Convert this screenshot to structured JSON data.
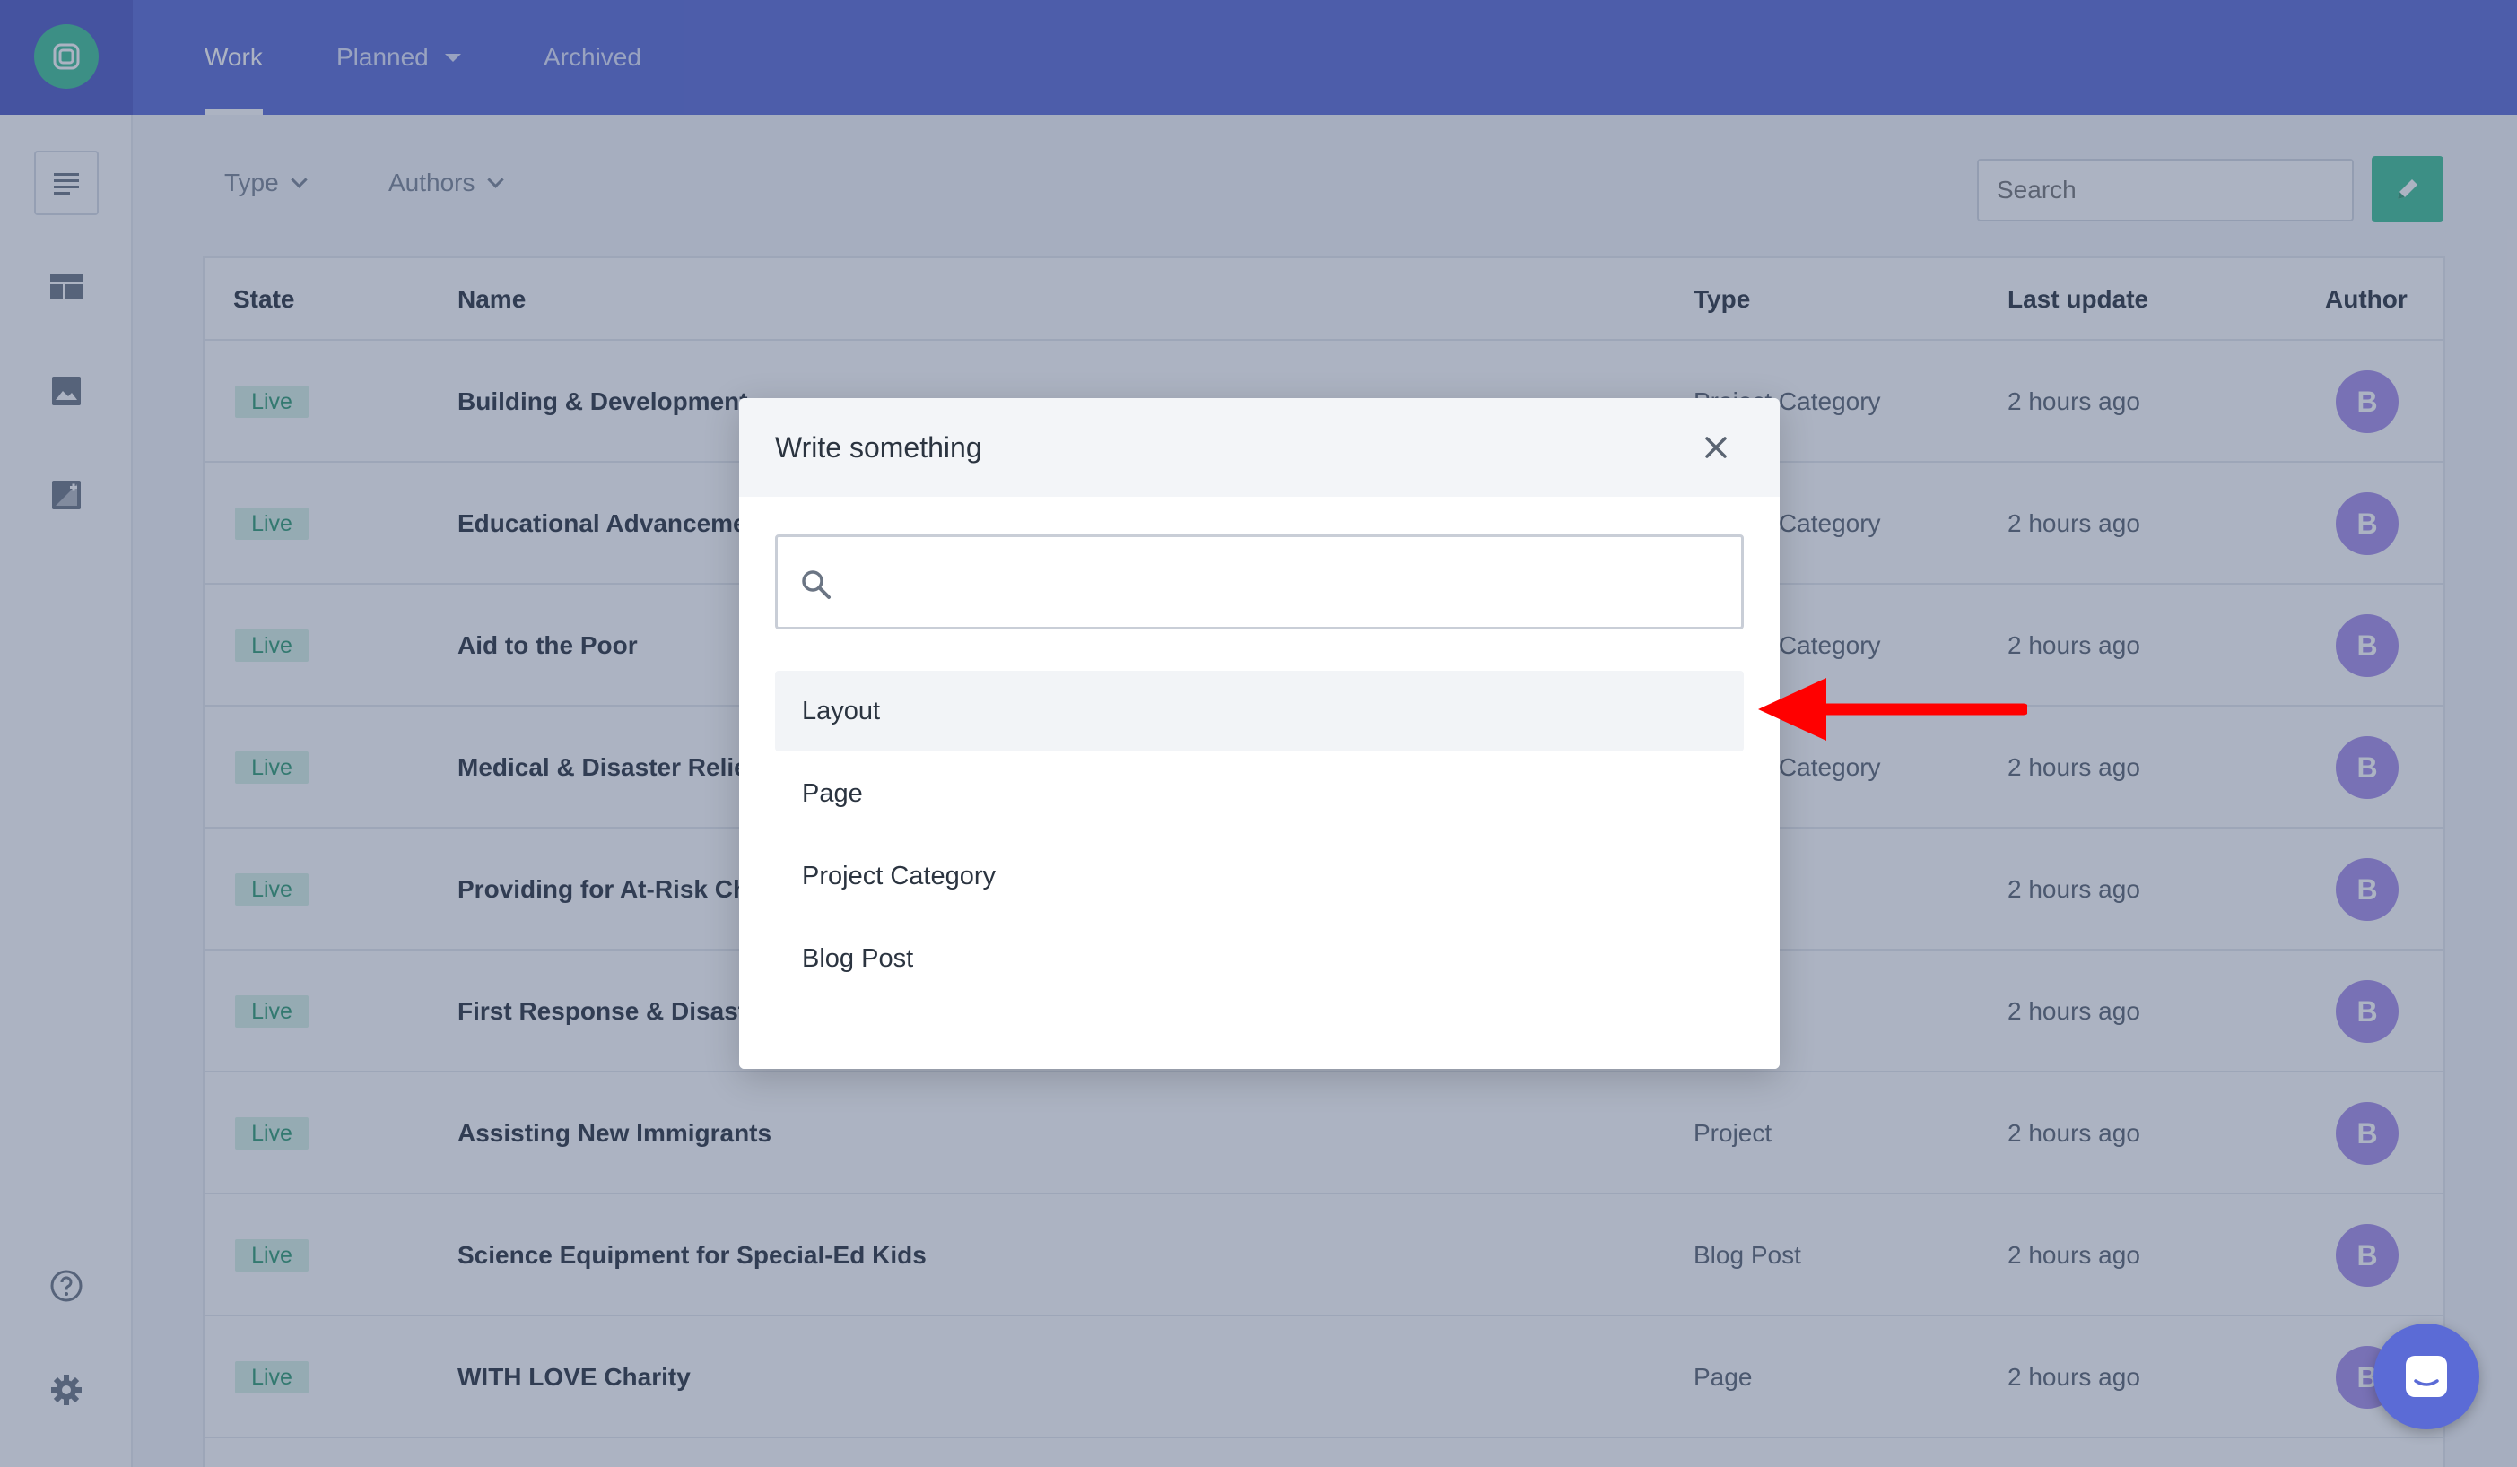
{
  "nav": {
    "tabs": [
      {
        "label": "Work",
        "active": true
      },
      {
        "label": "Planned",
        "has_dropdown": true
      },
      {
        "label": "Archived"
      }
    ]
  },
  "sidebar": {
    "icons": [
      "list-icon",
      "layout-icon",
      "image-icon",
      "image-edit-icon",
      "help-icon",
      "gear-icon"
    ]
  },
  "toolbar": {
    "filters": [
      {
        "label": "Type"
      },
      {
        "label": "Authors"
      }
    ],
    "search_placeholder": "Search",
    "edit_icon": "pencil-icon"
  },
  "table": {
    "columns": [
      "State",
      "Name",
      "Type",
      "Last update",
      "Author"
    ],
    "rows": [
      {
        "state": "Live",
        "name": "Building & Development",
        "type": "Project Category",
        "updated": "2 hours ago",
        "author": "B"
      },
      {
        "state": "Live",
        "name": "Educational Advancement",
        "type": "Project Category",
        "updated": "2 hours ago",
        "author": "B"
      },
      {
        "state": "Live",
        "name": "Aid to the Poor",
        "type": "Project Category",
        "updated": "2 hours ago",
        "author": "B"
      },
      {
        "state": "Live",
        "name": "Medical & Disaster Relief",
        "type": "Project Category",
        "updated": "2 hours ago",
        "author": "B"
      },
      {
        "state": "Live",
        "name": "Providing for At-Risk Children",
        "type": "",
        "updated": "2 hours ago",
        "author": "B"
      },
      {
        "state": "Live",
        "name": "First Response & Disaster",
        "type": "",
        "updated": "2 hours ago",
        "author": "B"
      },
      {
        "state": "Live",
        "name": "Assisting New Immigrants",
        "type": "Project",
        "updated": "2 hours ago",
        "author": "B"
      },
      {
        "state": "Live",
        "name": "Science Equipment for Special-Ed Kids",
        "type": "Blog Post",
        "updated": "2 hours ago",
        "author": "B"
      },
      {
        "state": "Live",
        "name": "WITH LOVE Charity",
        "type": "Page",
        "updated": "2 hours ago",
        "author": "B"
      }
    ]
  },
  "modal": {
    "title": "Write something",
    "search_value": "",
    "options": [
      "Layout",
      "Page",
      "Project Category",
      "Blog Post"
    ],
    "highlighted_option": "Layout"
  },
  "colors": {
    "topbar": "#5b6bd6",
    "accent_green": "#3fc196",
    "avatar": "#a58de8",
    "annotation_arrow": "#ff0000"
  }
}
